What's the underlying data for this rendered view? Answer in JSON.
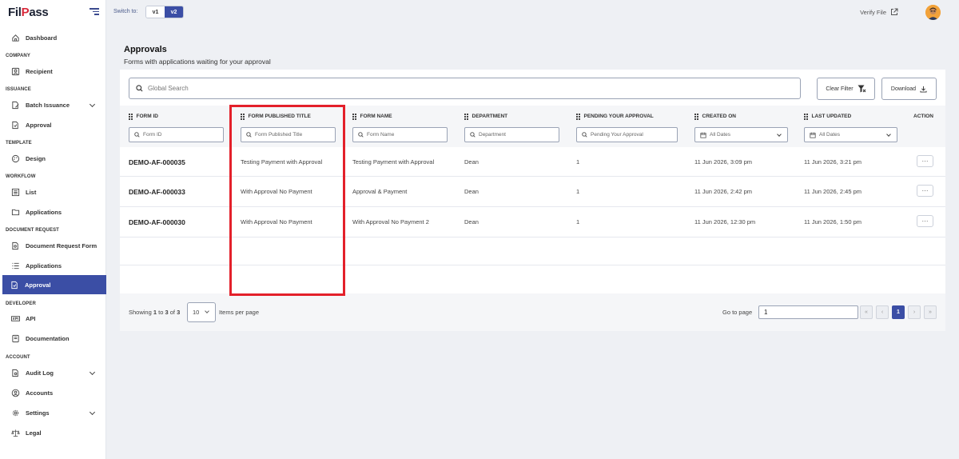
{
  "brand": {
    "logo_pre": "Fil",
    "logo_v": "P",
    "logo_post": "ass"
  },
  "topbar": {
    "switch_label": "Switch to:",
    "v1": "v1",
    "v2": "v2",
    "verify": "Verify File"
  },
  "sidebar": {
    "dashboard": "Dashboard",
    "company": "COMPANY",
    "recipient": "Recipient",
    "issuance": "ISSUANCE",
    "batch_issuance": "Batch Issuance",
    "approval_issuance": "Approval",
    "template": "TEMPLATE",
    "design": "Design",
    "workflow": "WORKFLOW",
    "list": "List",
    "applications_wf": "Applications",
    "document_request": "DOCUMENT REQUEST",
    "document_request_form": "Document Request Form",
    "applications_dr": "Applications",
    "approval_dr": "Approval",
    "developer": "DEVELOPER",
    "api": "API",
    "documentation": "Documentation",
    "account": "ACCOUNT",
    "audit_log": "Audit Log",
    "accounts": "Accounts",
    "settings": "Settings",
    "legal": "Legal"
  },
  "page": {
    "title": "Approvals",
    "subtitle": "Forms with applications waiting for your approval"
  },
  "toolbar": {
    "search_placeholder": "Global Search",
    "clear_filter": "Clear Filter",
    "download": "Download"
  },
  "columns": [
    {
      "label": "FORM ID",
      "filter": "Form ID"
    },
    {
      "label": "FORM PUBLISHED TITLE",
      "filter": "Form Published Title"
    },
    {
      "label": "FORM NAME",
      "filter": "Form Name"
    },
    {
      "label": "DEPARTMENT",
      "filter": "Department"
    },
    {
      "label": "PENDING YOUR APPROVAL",
      "filter": "Pending Your Approval"
    },
    {
      "label": "CREATED ON",
      "filter": "All Dates"
    },
    {
      "label": "LAST UPDATED",
      "filter": "All Dates"
    },
    {
      "label": "ACTION",
      "filter": ""
    }
  ],
  "rows": [
    {
      "form_id": "DEMO-AF-000035",
      "title": "Testing Payment with Approval",
      "name": "Testing Payment with Approval",
      "department": "Dean",
      "pending": "1",
      "created": "11 Jun 2026, 3:09 pm",
      "updated": "11 Jun 2026, 3:21 pm",
      "action": "···"
    },
    {
      "form_id": "DEMO-AF-000033",
      "title": "With Approval No Payment",
      "name": "Approval & Payment",
      "department": "Dean",
      "pending": "1",
      "created": "11 Jun 2026, 2:42 pm",
      "updated": "11 Jun 2026, 2:45 pm",
      "action": "···"
    },
    {
      "form_id": "DEMO-AF-000030",
      "title": "With Approval No Payment",
      "name": "With Approval No Payment 2",
      "department": "Dean",
      "pending": "1",
      "created": "11 Jun 2026, 12:30 pm",
      "updated": "11 Jun 2026, 1:50 pm",
      "action": "···"
    }
  ],
  "footer": {
    "showing_pre": "Showing",
    "from": "1",
    "to_word": "to",
    "to": "3",
    "of_word": "of",
    "total": "3",
    "per_page": "10",
    "items_per_page": "Items per page",
    "go_to_page": "Go to page",
    "page_input": "1",
    "first": "«",
    "prev": "‹",
    "current": "1",
    "next": "›",
    "last": "»"
  },
  "colors": {
    "accent": "#3b4ea5",
    "highlight": "#e3202a"
  }
}
